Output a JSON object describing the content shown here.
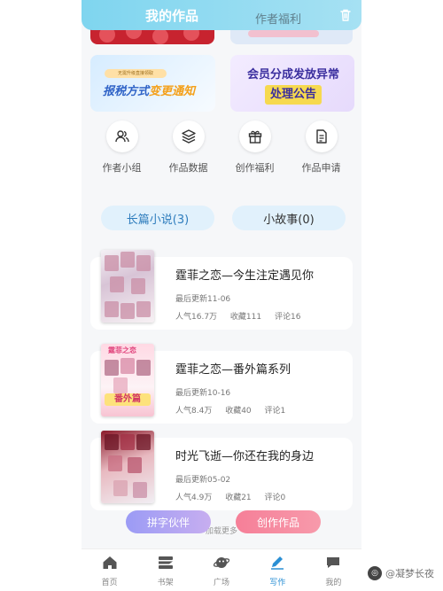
{
  "header": {
    "tab_active": "我的作品",
    "tab_inactive": "作者福利"
  },
  "banners": {
    "b1_small": "无需升级直接领取",
    "b1_title_a": "报税方式",
    "b1_title_b": "变更通知",
    "b2_line1": "会员分成发放异常",
    "b2_line2": "处理公告"
  },
  "actions": [
    {
      "label": "作者小组",
      "icon": "people-icon"
    },
    {
      "label": "作品数据",
      "icon": "layers-icon"
    },
    {
      "label": "创作福利",
      "icon": "gift-icon"
    },
    {
      "label": "作品申请",
      "icon": "document-icon"
    }
  ],
  "categories": [
    {
      "label": "长篇小说(3)"
    },
    {
      "label": "小故事(0)"
    }
  ],
  "works": [
    {
      "title": "霆菲之恋—今生注定遇见你",
      "updated": "最后更新11-06",
      "popularity": "人气16.7万",
      "favorites": "收藏111",
      "comments": "评论16"
    },
    {
      "title": "霆菲之恋—番外篇系列",
      "updated": "最后更新10-16",
      "popularity": "人气8.4万",
      "favorites": "收藏40",
      "comments": "评论1",
      "cover_top": "霆菲之恋",
      "cover_tag": "番外篇"
    },
    {
      "title": "时光飞逝—你还在我的身边",
      "updated": "最后更新05-02",
      "popularity": "人气4.9万",
      "favorites": "收藏21",
      "comments": "评论0"
    }
  ],
  "load_more": "加载更多",
  "fabs": {
    "partner": "拼字伙伴",
    "create": "创作作品"
  },
  "nav": [
    {
      "label": "首页",
      "icon": "home-icon"
    },
    {
      "label": "书架",
      "icon": "bookshelf-icon"
    },
    {
      "label": "广场",
      "icon": "planet-icon"
    },
    {
      "label": "写作",
      "icon": "pen-icon"
    },
    {
      "label": "我的",
      "icon": "chat-icon"
    }
  ],
  "watermark": "@凝梦长夜",
  "colors": {
    "accent": "#2a8fd4",
    "header": "#7fd5ef",
    "fab_partner": "#9b9bf5",
    "fab_create": "#f67f98"
  }
}
